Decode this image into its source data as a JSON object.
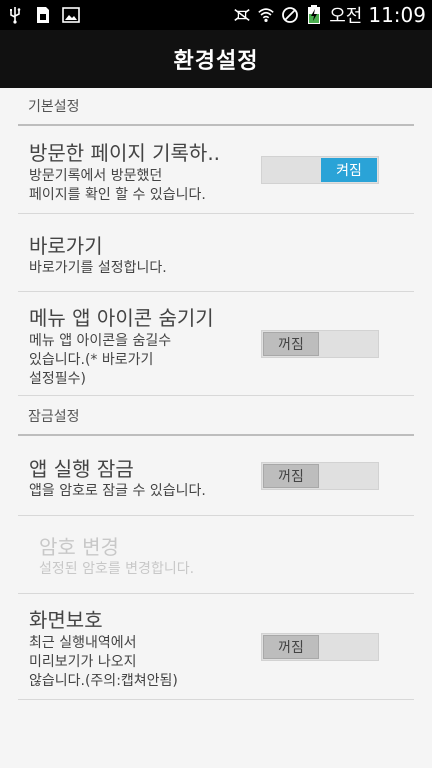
{
  "status_bar": {
    "icons": [
      "usb-icon",
      "sim-icon",
      "image-icon",
      "mute-icon",
      "wifi-icon",
      "blocked-icon",
      "battery-icon"
    ],
    "ampm": "오전",
    "time": "11:09"
  },
  "header": {
    "title": "환경설정"
  },
  "sections": {
    "basic": {
      "label": "기본설정"
    },
    "lock": {
      "label": "잠금설정"
    }
  },
  "rows": {
    "record_pages": {
      "title": "방문한 페이지 기록하..",
      "subtitle": "방문기록에서 방문했던\n페이지를 확인 할 수 있습니다.",
      "toggle": "켜짐",
      "on": true
    },
    "shortcut": {
      "title": "바로가기",
      "subtitle": "바로가기를 설정합니다."
    },
    "hide_icon": {
      "title": "메뉴 앱 아이콘 숨기기",
      "subtitle": "메뉴 앱 아이콘을 숨길수\n있습니다.(* 바로가기\n설정필수)",
      "toggle": "꺼짐",
      "on": false
    },
    "app_lock": {
      "title": "앱 실행 잠금",
      "subtitle": "앱을 암호로 잠글 수 있습니다.",
      "toggle": "꺼짐",
      "on": false
    },
    "change_password": {
      "title": "암호 변경",
      "subtitle": "설정된 암호를 변경합니다.",
      "disabled": true
    },
    "screen_protect": {
      "title": "화면보호",
      "subtitle": "최근 실행내역에서\n미리보기가 나오지\n않습니다.(주의:캡쳐안됨)",
      "toggle": "꺼짐",
      "on": false
    }
  },
  "colors": {
    "accent": "#2aa3d7",
    "header_bg": "#111111",
    "status_bg": "#000000",
    "background": "#f5f5f5"
  }
}
